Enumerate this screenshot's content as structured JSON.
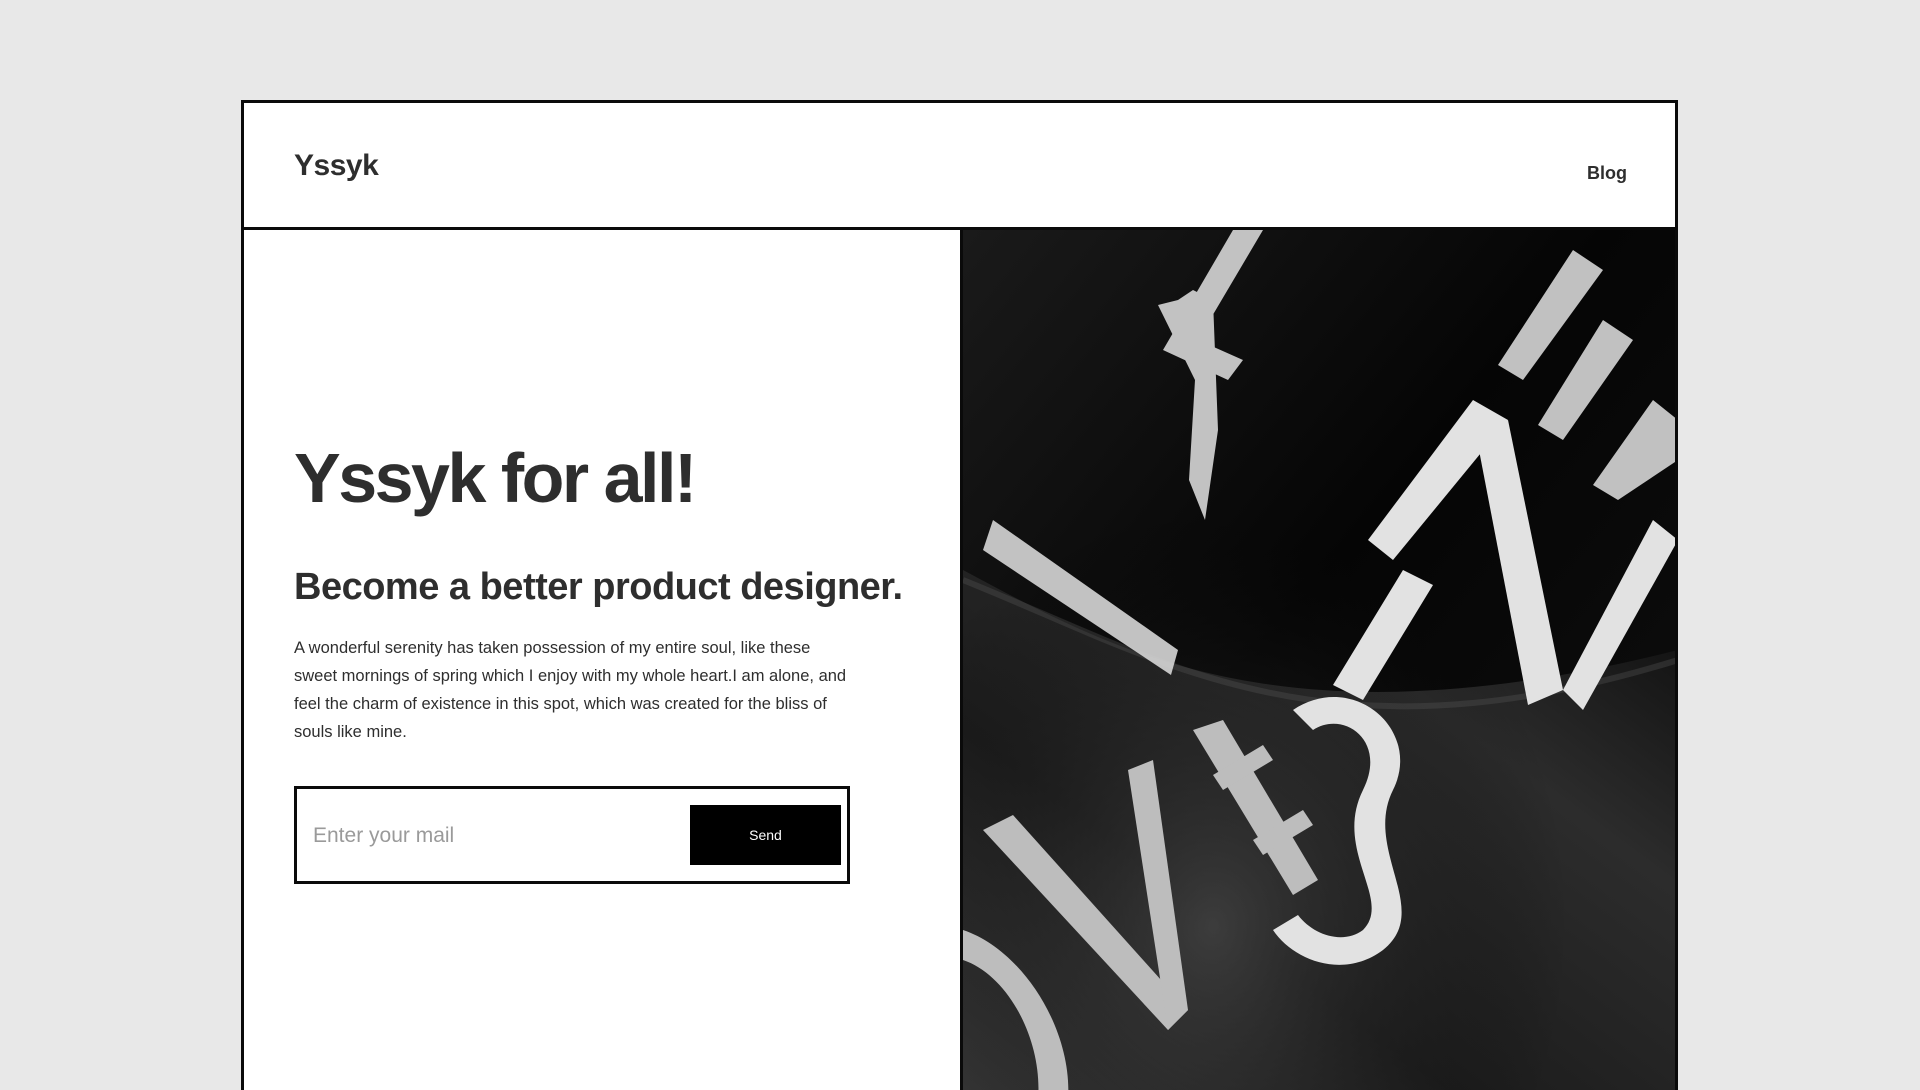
{
  "header": {
    "logo": "Yssyk",
    "nav": {
      "blog_label": "Blog"
    }
  },
  "hero": {
    "title": "Yssyk for all!",
    "subtitle": "Become a better product designer.",
    "body": "A wonderful serenity has taken possession of my entire soul, like these sweet mornings of spring which I enjoy with my whole heart.I am alone, and feel the charm of existence in this spot, which was created for the bliss of souls like mine."
  },
  "signup": {
    "email_placeholder": "Enter your mail",
    "email_value": "",
    "send_label": "Send"
  },
  "photo": {
    "printed_letters_top": "STYLE",
    "printed_letters_middle": "SIZE",
    "printed_letters_bottom": "OVE"
  },
  "colors": {
    "background": "#e8e8e8",
    "frame_border": "#0a0a0a",
    "text": "#2e2e2e",
    "button_bg": "#000000",
    "button_text": "#ffffff",
    "placeholder": "#9a9a9a"
  }
}
